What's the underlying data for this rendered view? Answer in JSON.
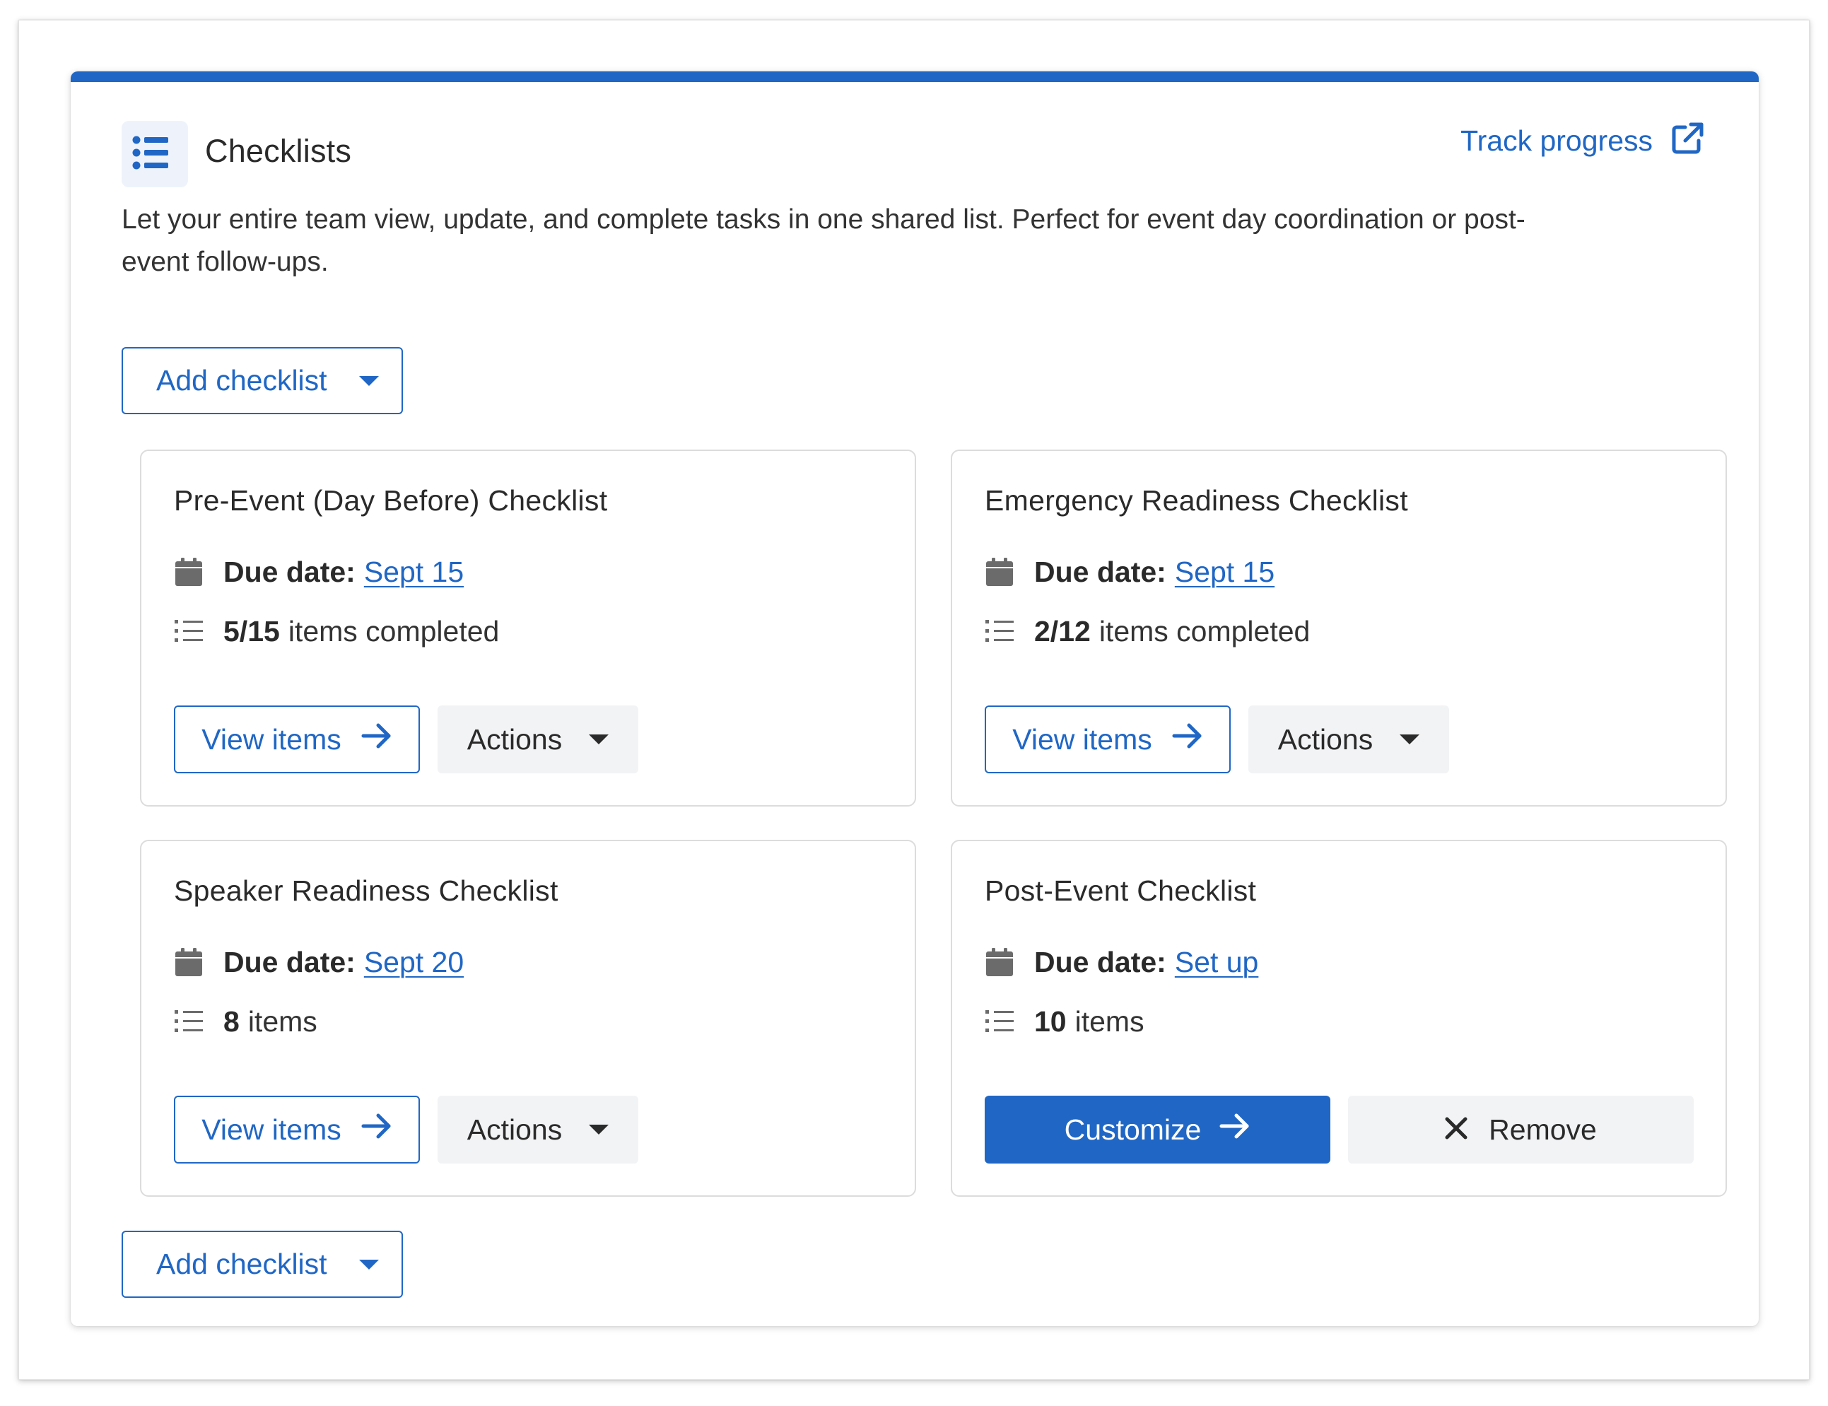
{
  "header": {
    "title": "Checklists",
    "track_link": "Track progress",
    "description": "Let your entire team view, update, and complete tasks in one shared list. Perfect for event day coordination or post-event follow-ups."
  },
  "add_checklist_label": "Add checklist",
  "due_label": "Due date:",
  "cards": [
    {
      "title": "Pre-Event (Day Before) Checklist",
      "due_value": "Sept 15",
      "count_strong": "5/15",
      "count_text": "items completed",
      "primary_label": "View items",
      "secondary_label": "Actions"
    },
    {
      "title": "Emergency Readiness Checklist",
      "due_value": "Sept 15",
      "count_strong": "2/12",
      "count_text": "items completed",
      "primary_label": "View items",
      "secondary_label": "Actions"
    },
    {
      "title": "Speaker Readiness Checklist",
      "due_value": "Sept 20",
      "count_strong": "8",
      "count_text": "items",
      "primary_label": "View items",
      "secondary_label": "Actions"
    },
    {
      "title": "Post-Event Checklist",
      "due_value": "Set up",
      "count_strong": "10",
      "count_text": "items",
      "primary_label": "Customize",
      "secondary_label": "Remove"
    }
  ],
  "colors": {
    "accent": "#2067c5",
    "neutral_button_bg": "#f2f3f5",
    "card_border": "#dcdcdc",
    "icon_gray": "#6b6b6b"
  },
  "icons": {
    "header": "list-icon",
    "track": "external-link-icon",
    "due": "calendar-icon",
    "count": "list-icon",
    "view": "arrow-right-icon",
    "actions": "caret-down-icon",
    "remove": "close-icon"
  }
}
